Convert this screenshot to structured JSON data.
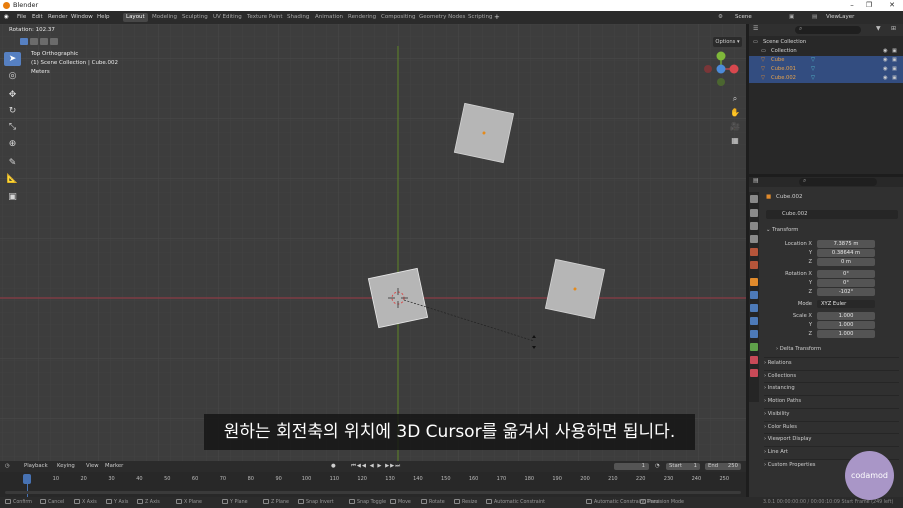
{
  "window": {
    "title": "Blender"
  },
  "menu": [
    "File",
    "Edit",
    "Render",
    "Window",
    "Help"
  ],
  "workspaces": [
    {
      "label": "Layout",
      "active": true
    },
    {
      "label": "Modeling"
    },
    {
      "label": "Sculpting"
    },
    {
      "label": "UV Editing"
    },
    {
      "label": "Texture Paint"
    },
    {
      "label": "Shading"
    },
    {
      "label": "Animation"
    },
    {
      "label": "Rendering"
    },
    {
      "label": "Compositing"
    },
    {
      "label": "Geometry Nodes"
    },
    {
      "label": "Scripting"
    }
  ],
  "scene": {
    "name": "Scene",
    "view_layer": "ViewLayer"
  },
  "viewport": {
    "operator_text": "Rotation: 102.37",
    "view_name": "Top Orthographic",
    "collection_path": "(1) Scene Collection | Cube.002",
    "units": "Meters",
    "options_label": "Options"
  },
  "subtitle": "원하는 회전축의 위치에 3D Cursor를 옮겨서 사용하면 됩니다.",
  "outliner": {
    "items": [
      {
        "label": "Scene Collection",
        "selected": false
      },
      {
        "label": "Collection",
        "selected": false
      },
      {
        "label": "Cube",
        "selected": true
      },
      {
        "label": "Cube.001",
        "selected": true
      },
      {
        "label": "Cube.002",
        "selected": true
      }
    ]
  },
  "properties": {
    "object_name": "Cube.002",
    "data_name": "Cube.002",
    "transform_label": "Transform",
    "location": {
      "label": "Location X",
      "x": "7.3875 m",
      "y": "0.38644 m",
      "z": "0 m"
    },
    "rotation": {
      "label": "Rotation X",
      "x": "0°",
      "y": "0°",
      "z": "-102°"
    },
    "mode": {
      "label": "Mode",
      "value": "XYZ Euler"
    },
    "scale": {
      "label": "Scale X",
      "x": "1.000",
      "y": "1.000",
      "z": "1.000"
    },
    "axis_y": "Y",
    "axis_z": "Z",
    "delta_label": "Delta Transform",
    "sections": [
      "Relations",
      "Collections",
      "Instancing",
      "Motion Paths",
      "Visibility",
      "Color Rules",
      "Viewport Display",
      "Line Art",
      "Custom Properties"
    ]
  },
  "timeline": {
    "menus": [
      "Playback",
      "Keying",
      "View",
      "Marker"
    ],
    "current_frame": "1",
    "start_label": "Start",
    "start": "1",
    "end_label": "End",
    "end": "250",
    "ticks": [
      "0",
      "10",
      "20",
      "30",
      "40",
      "50",
      "60",
      "70",
      "80",
      "90",
      "100",
      "110",
      "120",
      "130",
      "140",
      "150",
      "160",
      "170",
      "180",
      "190",
      "200",
      "210",
      "220",
      "230",
      "240",
      "250"
    ]
  },
  "statusbar": {
    "items": [
      "Confirm",
      "Cancel",
      "X Axis",
      "Y Axis",
      "Z Axis",
      "X Plane",
      "Y Plane",
      "Z Plane",
      "Snap Invert",
      "Snap Toggle",
      "Move",
      "Rotate",
      "Resize",
      "Automatic Constraint",
      "Automatic Constraint Plane",
      "Precision Mode"
    ],
    "version": "3.0.1  00:00:00:00 / 00:00:10:09  Start Frame (249 left)"
  },
  "watermark": "codamod"
}
